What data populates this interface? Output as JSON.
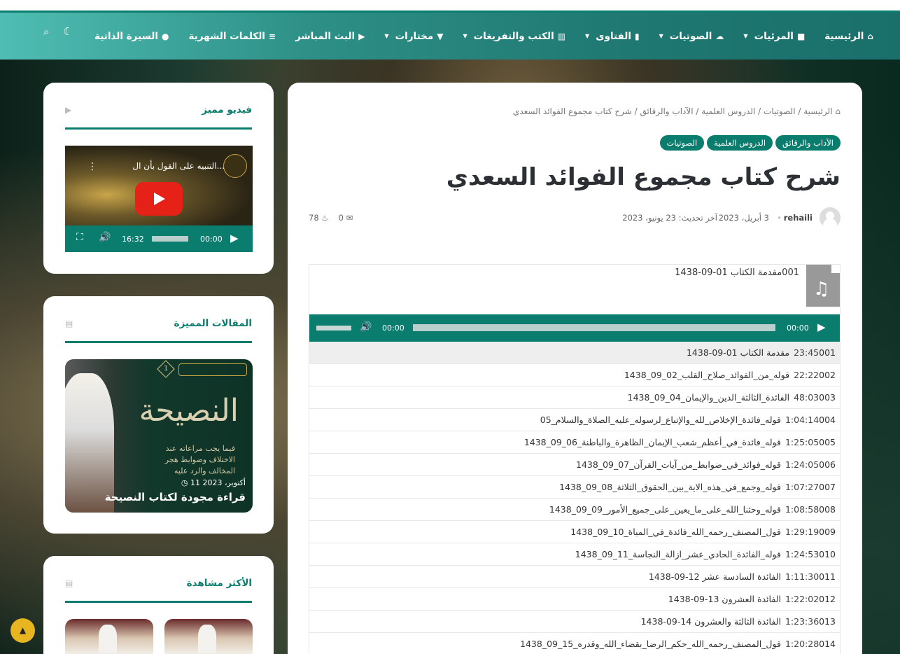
{
  "nav": {
    "items": [
      {
        "label": "الرئيسية",
        "icon": "home-icon",
        "glyph": "⌂",
        "dropdown": false
      },
      {
        "label": "المرئيات",
        "icon": "video-camera-icon",
        "glyph": "■",
        "dropdown": true
      },
      {
        "label": "الصوتيات",
        "icon": "cloud-icon",
        "glyph": "☁",
        "dropdown": true
      },
      {
        "label": "الفتاوى",
        "icon": "book-icon",
        "glyph": "▮",
        "dropdown": true
      },
      {
        "label": "الكتب والتفريغات",
        "icon": "open-book-icon",
        "glyph": "▥",
        "dropdown": true
      },
      {
        "label": "مختارات",
        "icon": "bookmark-icon",
        "glyph": "▼",
        "dropdown": true
      },
      {
        "label": "البث المباشر",
        "icon": "youtube-icon",
        "glyph": "▶",
        "dropdown": false
      },
      {
        "label": "الكلمات الشهرية",
        "icon": "list-icon",
        "glyph": "≡",
        "dropdown": false
      },
      {
        "label": "السيرة الذاتية",
        "icon": "user-icon",
        "glyph": "●",
        "dropdown": false
      }
    ],
    "tools": [
      {
        "name": "moon-icon",
        "glyph": "☾"
      },
      {
        "name": "search-icon",
        "glyph": "⌕"
      }
    ]
  },
  "breadcrumb": {
    "home": "الرئيسية",
    "items": [
      "الصوتيات",
      "الدروس العلمية",
      "الآداب والرقائق",
      "شرح كتاب مجموع الفوائد السعدي"
    ],
    "separator": " / "
  },
  "categories": [
    "الآداب والرقائق",
    "الدروس العلمية",
    "الصوتيات"
  ],
  "post": {
    "title": "شرح كتاب مجموع الفوائد السعدي",
    "author": "rehaili",
    "date": "3 أبريل، 2023",
    "updated": "آخر تحديث: 23 يونيو، 2023",
    "comments": "0",
    "views": "78"
  },
  "playlist": {
    "current_title": "001مقدمة الكتاب 01-09-1438",
    "time_current": "00:00",
    "time_total": "00:00",
    "tracks": [
      {
        "title": "001مقدمة الكتاب 01-09-1438",
        "duration": "23:45"
      },
      {
        "title": "002قوله_من_الفوائد_صلاح_القلب_02_09_1438",
        "duration": "22:22"
      },
      {
        "title": "003الفائدة_الثالثة_الدين_والإيمان_04_09_1438",
        "duration": "48:03"
      },
      {
        "title": "004قوله_فائدة_الإخلاص_لله_والإتباع_لرسوله_عليه_الصلاة_والسلام_05",
        "duration": "1:04:14"
      },
      {
        "title": "005قوله_فائدة_في_أعظم_شعب_الإيمان_الظاهرة_والباطنة_06_09_1438",
        "duration": "1:25:05"
      },
      {
        "title": "006قوله_فوائد_في_ضوابط_من_آيات_القرآن_07_09_1438",
        "duration": "1:24:05"
      },
      {
        "title": "007قوله_وجمع_في_هذه_الاية_بين_الحقوق_الثلاثة_08_09_1438",
        "duration": "1:07:27"
      },
      {
        "title": "008قوله_وحثنا_الله_على_ما_يعين_على_جميع_الأمور_09_09_1438",
        "duration": "1:08:58"
      },
      {
        "title": "009قول_المصنف_رحمه_الله_فائدة_في_المياة_10_09_1438",
        "duration": "1:29:19"
      },
      {
        "title": "010قوله_الفائدة_الحادي_عشر_ازالة_النجاسة_11_09_1438",
        "duration": "1:24:53"
      },
      {
        "title": "011الفائدة السادسة عشر 12-09-1438",
        "duration": "1:11:30"
      },
      {
        "title": "012الفائدة العشرون 13-09-1438",
        "duration": "1:22:02"
      },
      {
        "title": "013الفائدة الثالثة والعشرون 14-09-1438",
        "duration": "1:23:36"
      },
      {
        "title": "014قول_المصنف_رحمه_الله_حكم_الرضا_بقضاء_الله_وقدره_15_09_1438",
        "duration": "1:20:28"
      }
    ]
  },
  "widgets": {
    "video": {
      "title": "فيديو مميز",
      "video_title": "التنبيه على القول بأن ال...",
      "current": "00:00",
      "duration": "16:32"
    },
    "featured": {
      "title": "المقالات المميزة",
      "badge": "1",
      "big_text": "النصيحة",
      "sub_text": "فيما يجب مراعاته عند الاختلاف وضوابط هجر المخالف والرد عليه",
      "date": "11 أكتوبر، 2023",
      "post_title": "قراءة مجودة لكتاب النصيحة"
    },
    "popular": {
      "title": "الأكثر مشاهدة"
    }
  },
  "colors": {
    "accent": "#0b7d6f",
    "scrolltop": "#e7b51f"
  }
}
